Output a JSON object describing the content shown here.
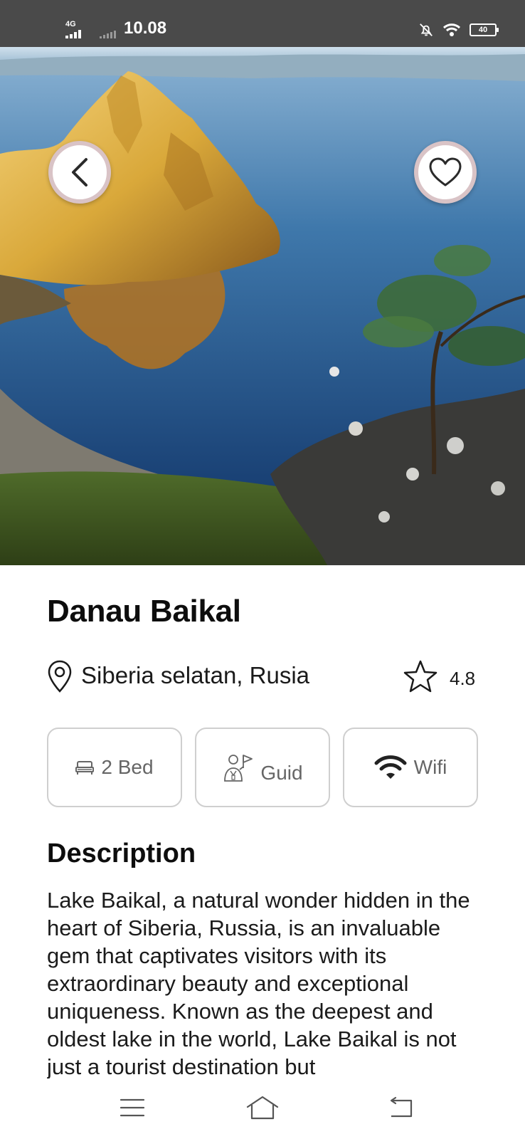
{
  "status_bar": {
    "network": "4G",
    "time": "10.08",
    "battery": "40"
  },
  "hero": {
    "image_alt": "Lake Baikal rock formation",
    "back_icon": "chevron-left-icon",
    "favorite_icon": "heart-outline-icon"
  },
  "place": {
    "title": "Danau Baikal",
    "location": "Siberia selatan, Rusia",
    "rating": "4.8"
  },
  "facilities": [
    {
      "label": "2 Bed",
      "icon": "bed-icon"
    },
    {
      "label": "Guid",
      "icon": "tour-guide-icon"
    },
    {
      "label": "Wifi",
      "icon": "wifi-icon"
    }
  ],
  "description": {
    "title": "Description",
    "text": "Lake Baikal, a natural wonder hidden in the heart of Siberia, Russia, is an invaluable gem that captivates visitors with its extraordinary beauty and exceptional uniqueness. Known as the deepest and oldest lake in the world, Lake Baikal is not just a tourist destination but"
  },
  "nav": {
    "menu_icon": "menu-icon",
    "home_icon": "home-icon",
    "back_icon": "back-icon"
  },
  "colors": {
    "status_bar_bg": "#4a4a4a",
    "button_ring": "#d9c3c6",
    "card_border": "#cfcfcf",
    "muted_text": "#666666"
  }
}
